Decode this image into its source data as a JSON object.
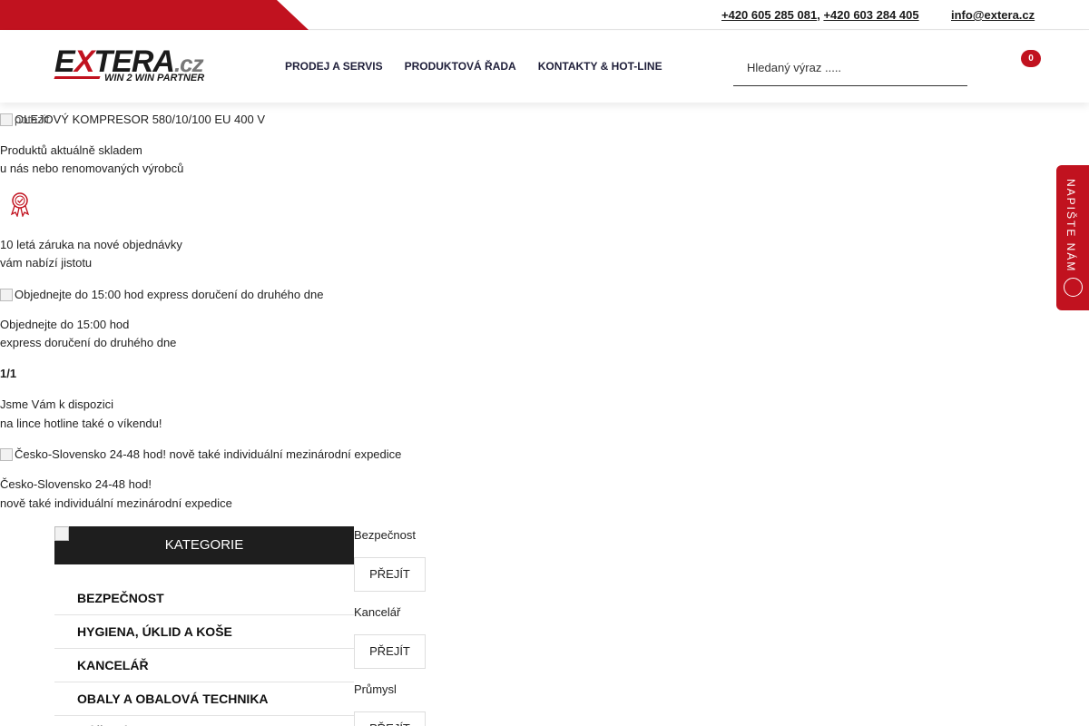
{
  "topbar": {
    "phone1": "+420 605 285 081",
    "separator": ",",
    "phone2": "+420 603 284 405",
    "email": "info@extera.cz"
  },
  "header": {
    "logo": {
      "brand_ex": "E",
      "brand_x": "X",
      "brand_rest": "TERA",
      "brand_tld": ".cz",
      "tagline": "WIN 2 WIN PARTNER"
    },
    "nav": [
      "PRODEJ A SERVIS",
      "PRODUKTOVÁ ŘADA",
      "KONTAKTY & HOT-LINE"
    ],
    "search": {
      "placeholder": "Hledaný výraz ....."
    },
    "cart_count": "0"
  },
  "features": [
    {
      "image_alt": "OLEJOVÝ KOMPRESOR 580/10/100 EU 400 V",
      "image_alt_overlay": "potazit",
      "line1": "Produktů aktuálně skladem",
      "line2": "u nás nebo renomovaných výrobců"
    },
    {
      "icon": "award-icon",
      "line1": "10 letá záruka na nové objednávky",
      "line2": "vám nabízí jistotu"
    },
    {
      "image_alt": "Objednejte do 15:00 hod express doručení do druhého dne",
      "line1": "Objednejte do 15:00 hod",
      "line2": "express doručení do druhého dne"
    },
    {
      "counter": "1/1",
      "line1": "Jsme Vám k dispozici",
      "line2": "na lince hotline také o víkendu!"
    },
    {
      "image_alt": "Česko-Slovensko 24-48 hod! nově také individuální mezinárodní expedice",
      "line1": "Česko-Slovensko 24-48 hod!",
      "line2": "nově také individuální mezinárodní expedice"
    }
  ],
  "sidetab": {
    "label": "NAPIŠTE NÁM"
  },
  "categories": {
    "title": "KATEGORIE",
    "items": [
      "BEZPEČNOST",
      "HYGIENA, ÚKLID A KOŠE",
      "KANCELÁŘ",
      "OBALY A OBALOVÁ TECHNIKA",
      "NÁŘADÍ"
    ]
  },
  "tiles": [
    {
      "label": "Bezpečnost",
      "button": "PŘEJÍT"
    },
    {
      "label": "Kancelář",
      "button": "PŘEJÍT"
    },
    {
      "label": "Průmysl",
      "button": "PŘEJÍT"
    }
  ],
  "colors": {
    "brand_red": "#c1121f",
    "dark": "#1e1e1e"
  }
}
